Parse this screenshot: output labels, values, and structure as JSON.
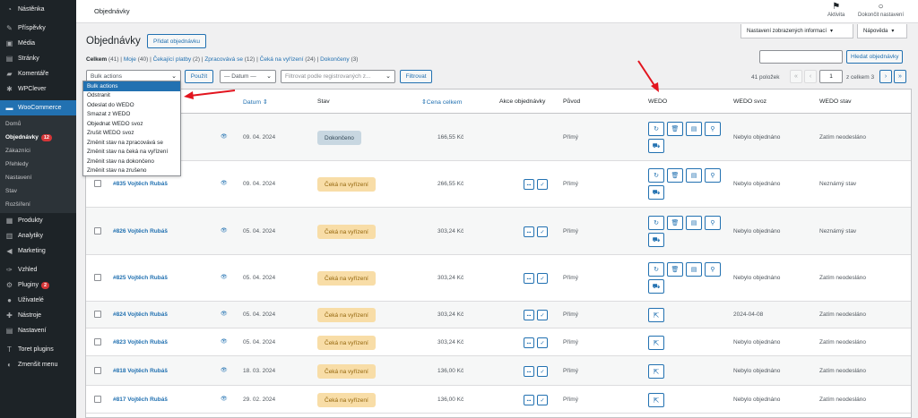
{
  "sidebar": {
    "items_top": [
      {
        "label": "Nástěnka",
        "icon": "dashboard-icon",
        "glyph": "◔"
      },
      {
        "label": "Příspěvky",
        "icon": "pushpin-icon",
        "glyph": "✎"
      },
      {
        "label": "Média",
        "icon": "media-icon",
        "glyph": "▣"
      },
      {
        "label": "Stránky",
        "icon": "pages-icon",
        "glyph": "▤"
      },
      {
        "label": "Komentáře",
        "icon": "comments-icon",
        "glyph": "▰"
      },
      {
        "label": "WPClever",
        "icon": "wpclever-icon",
        "glyph": "✱"
      }
    ],
    "woocommerce": {
      "label": "WooCommerce",
      "icon": "woocommerce-icon",
      "glyph": "▬"
    },
    "submenu": [
      {
        "label": "Domů",
        "current": false
      },
      {
        "label": "Objednávky",
        "current": true,
        "badge": "12"
      },
      {
        "label": "Zákazníci",
        "current": false
      },
      {
        "label": "Přehledy",
        "current": false
      },
      {
        "label": "Nastavení",
        "current": false
      },
      {
        "label": "Stav",
        "current": false
      },
      {
        "label": "Rozšíření",
        "current": false
      }
    ],
    "items_bottom": [
      {
        "label": "Produkty",
        "icon": "products-icon",
        "glyph": "▦"
      },
      {
        "label": "Analytiky",
        "icon": "analytics-icon",
        "glyph": "▥"
      },
      {
        "label": "Marketing",
        "icon": "marketing-icon",
        "glyph": "◀"
      }
    ],
    "items_tools": [
      {
        "label": "Vzhled",
        "icon": "appearance-icon",
        "glyph": "✑"
      },
      {
        "label": "Pluginy",
        "icon": "plugins-icon",
        "glyph": "⚙",
        "badge": "2"
      },
      {
        "label": "Uživatelé",
        "icon": "users-icon",
        "glyph": "●"
      },
      {
        "label": "Nástroje",
        "icon": "tools-icon",
        "glyph": "✚"
      },
      {
        "label": "Nastavení",
        "icon": "settings-icon",
        "glyph": "▤"
      }
    ],
    "toret": {
      "label": "Toret plugins",
      "icon": "toret-icon",
      "glyph": "T"
    },
    "collapse": {
      "label": "Zmenšit menu",
      "icon": "collapse-icon",
      "glyph": "◐"
    }
  },
  "topbar": {
    "title": "Objednávky",
    "activity_label": "Aktivita",
    "finish_setup_label": "Dokončit nastavení"
  },
  "screen_options_label": "Nastavení zobrazených informací",
  "help_label": "Nápověda",
  "page": {
    "heading": "Objednávky",
    "add_order_label": "Přidat objednávku",
    "views": {
      "all": "Celkem",
      "all_count": "(41)",
      "mine": "Moje",
      "mine_count": "(40)",
      "pending": "Čekající platby",
      "pending_count": "(2)",
      "processing": "Zpracovává se",
      "processing_count": "(12)",
      "on_hold": "Čeká na vyřízení",
      "on_hold_count": "(24)",
      "completed": "Dokončeny",
      "completed_count": "(3)"
    },
    "search_button_label": "Hledat objednávky",
    "search_value": ""
  },
  "filters": {
    "bulk_action_value": "Bulk actions",
    "apply_label": "Použít",
    "date_value": "— Datum —",
    "customer_placeholder": "Filtrovat podle registrovaných z...",
    "filter_label": "Filtrovat"
  },
  "pagination": {
    "count_label": "41 položek",
    "first": "«",
    "prev": "‹",
    "next": "›",
    "last": "»",
    "current_page": "1",
    "of_label": "z celkem 3"
  },
  "bulk_dropdown": [
    {
      "label": "Bulk actions",
      "highlighted": true
    },
    {
      "label": "Odstranit",
      "highlighted": false
    },
    {
      "label": "Odeslat do WEDO",
      "highlighted": false
    },
    {
      "label": "Smazat z WEDO",
      "highlighted": false
    },
    {
      "label": "Objednat WEDO svoz",
      "highlighted": false
    },
    {
      "label": "Zrušit WEDO svoz",
      "highlighted": false
    },
    {
      "label": "Změnit stav na zpracovává se",
      "highlighted": false
    },
    {
      "label": "Změnit stav na čeká na vyřízení",
      "highlighted": false
    },
    {
      "label": "Změnit stav na dokončeno",
      "highlighted": false
    },
    {
      "label": "Změnit stav na zrušeno",
      "highlighted": false
    }
  ],
  "table": {
    "columns": {
      "date": "Datum",
      "status": "Stav",
      "total": "Cena celkem",
      "actions": "Akce objednávky",
      "origin": "Původ",
      "wedo": "WEDO",
      "wedo_pickup": "WEDO svoz",
      "wedo_status": "WEDO stav"
    },
    "rows": [
      {
        "order": "",
        "date": "09. 04. 2024",
        "status": "Dokončeno",
        "status_type": "done",
        "total": "166,55 Kč",
        "has_actions": false,
        "origin": "Přímý",
        "wedo_mode": "full",
        "wedo_pickup": "Nebylo objednáno",
        "wedo_status": "Zatím neodesláno"
      },
      {
        "order": "#835 Vojtěch Rubáš",
        "date": "09. 04. 2024",
        "status": "Čeká na vyřízení",
        "status_type": "hold",
        "total": "266,55 Kč",
        "has_actions": true,
        "origin": "Přímý",
        "wedo_mode": "full",
        "wedo_pickup": "Nebylo objednáno",
        "wedo_status": "Neznámý stav"
      },
      {
        "order": "#826 Vojtěch Rubáš",
        "date": "05. 04. 2024",
        "status": "Čeká na vyřízení",
        "status_type": "hold",
        "total": "303,24 Kč",
        "has_actions": true,
        "origin": "Přímý",
        "wedo_mode": "full",
        "wedo_pickup": "Nebylo objednáno",
        "wedo_status": "Neznámý stav"
      },
      {
        "order": "#825 Vojtěch Rubáš",
        "date": "05. 04. 2024",
        "status": "Čeká na vyřízení",
        "status_type": "hold",
        "total": "303,24 Kč",
        "has_actions": true,
        "origin": "Přímý",
        "wedo_mode": "full",
        "wedo_pickup": "Nebylo objednáno",
        "wedo_status": "Zatím neodesláno"
      },
      {
        "order": "#824 Vojtěch Rubáš",
        "date": "05. 04. 2024",
        "status": "Čeká na vyřízení",
        "status_type": "hold",
        "total": "303,24 Kč",
        "has_actions": true,
        "origin": "Přímý",
        "wedo_mode": "send",
        "wedo_pickup": "2024-04-08",
        "wedo_status": "Zatím neodesláno"
      },
      {
        "order": "#823 Vojtěch Rubáš",
        "date": "05. 04. 2024",
        "status": "Čeká na vyřízení",
        "status_type": "hold",
        "total": "303,24 Kč",
        "has_actions": true,
        "origin": "Přímý",
        "wedo_mode": "send",
        "wedo_pickup": "Nebylo objednáno",
        "wedo_status": "Zatím neodesláno"
      },
      {
        "order": "#818 Vojtěch Rubáš",
        "date": "18. 03. 2024",
        "status": "Čeká na vyřízení",
        "status_type": "hold",
        "total": "136,00 Kč",
        "has_actions": true,
        "origin": "Přímý",
        "wedo_mode": "send",
        "wedo_pickup": "Nebylo objednáno",
        "wedo_status": "Zatím neodesláno"
      },
      {
        "order": "#817 Vojtěch Rubáš",
        "date": "29. 02. 2024",
        "status": "Čeká na vyřízení",
        "status_type": "hold",
        "total": "136,00 Kč",
        "has_actions": true,
        "origin": "Přímý",
        "wedo_mode": "send",
        "wedo_pickup": "Nebylo objednáno",
        "wedo_status": "Zatím neodesláno"
      }
    ]
  },
  "annotation_color": "#e2141e"
}
